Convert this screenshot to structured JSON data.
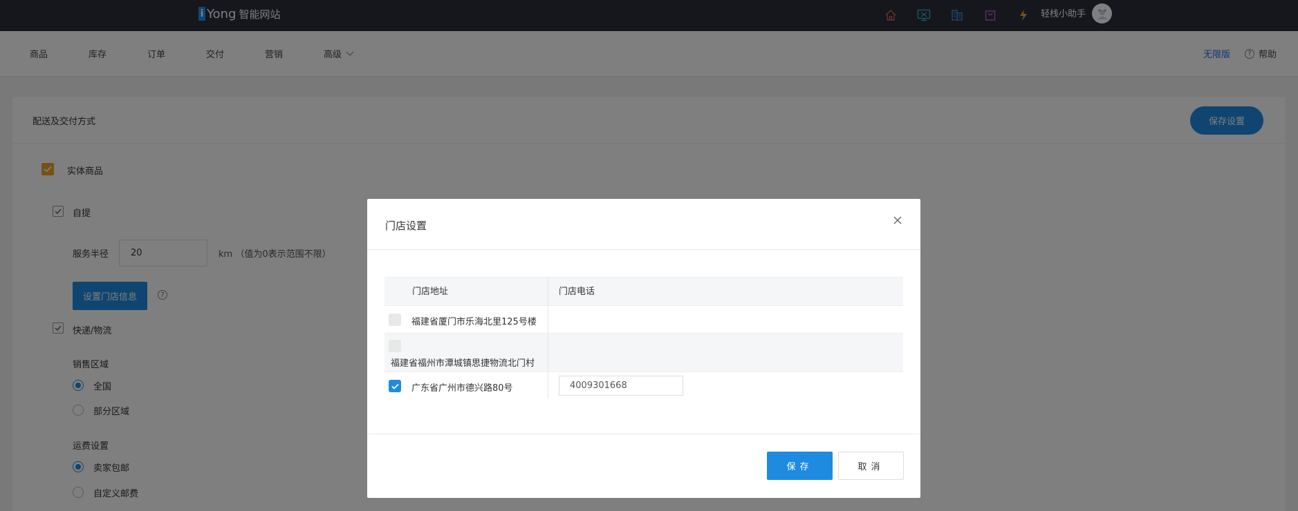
{
  "header": {
    "brand_badge": "i",
    "brand_name": "Yong",
    "brand_sub": "智能网站",
    "user_name": "轻栈小助手",
    "icons": [
      "home-icon",
      "monitor-icon",
      "building-icon",
      "shopping-bag-icon",
      "lightning-icon"
    ]
  },
  "nav": {
    "items": [
      "商品",
      "库存",
      "订单",
      "交付",
      "营销",
      "高级"
    ],
    "edition": "无限版",
    "help": "帮助"
  },
  "card": {
    "title": "配送及交付方式",
    "save_button": "保存设置",
    "physical_goods": "实体商品",
    "pickup": "自提",
    "service_radius_label": "服务半径",
    "service_radius_value": "20",
    "radius_unit_note": "km （值为0表示范围不限）",
    "store_info_button": "设置门店信息",
    "express": "快递/物流",
    "sales_region_label": "销售区域",
    "region_options": [
      "全国",
      "部分区域"
    ],
    "region_selected": "全国",
    "shipping_label": "运费设置",
    "shipping_options": [
      "卖家包邮",
      "自定义邮费"
    ],
    "shipping_selected": "卖家包邮"
  },
  "modal": {
    "title": "门店设置",
    "columns": [
      "门店地址",
      "门店电话"
    ],
    "rows": [
      {
        "address": "福建省厦门市乐海北里125号楼",
        "phone": "",
        "checked": false
      },
      {
        "address": "福建省福州市潭城镇思捷物流北门村",
        "phone": "",
        "checked": false
      },
      {
        "address": "广东省广州市德兴路80号",
        "phone": "4009301668",
        "checked": true
      }
    ],
    "save_button": "保存",
    "cancel_button": "取消"
  },
  "colors": {
    "accent": "#1e8be0",
    "header_bg": "#2b2f3a",
    "checkbox_orange": "#f1a02c"
  }
}
